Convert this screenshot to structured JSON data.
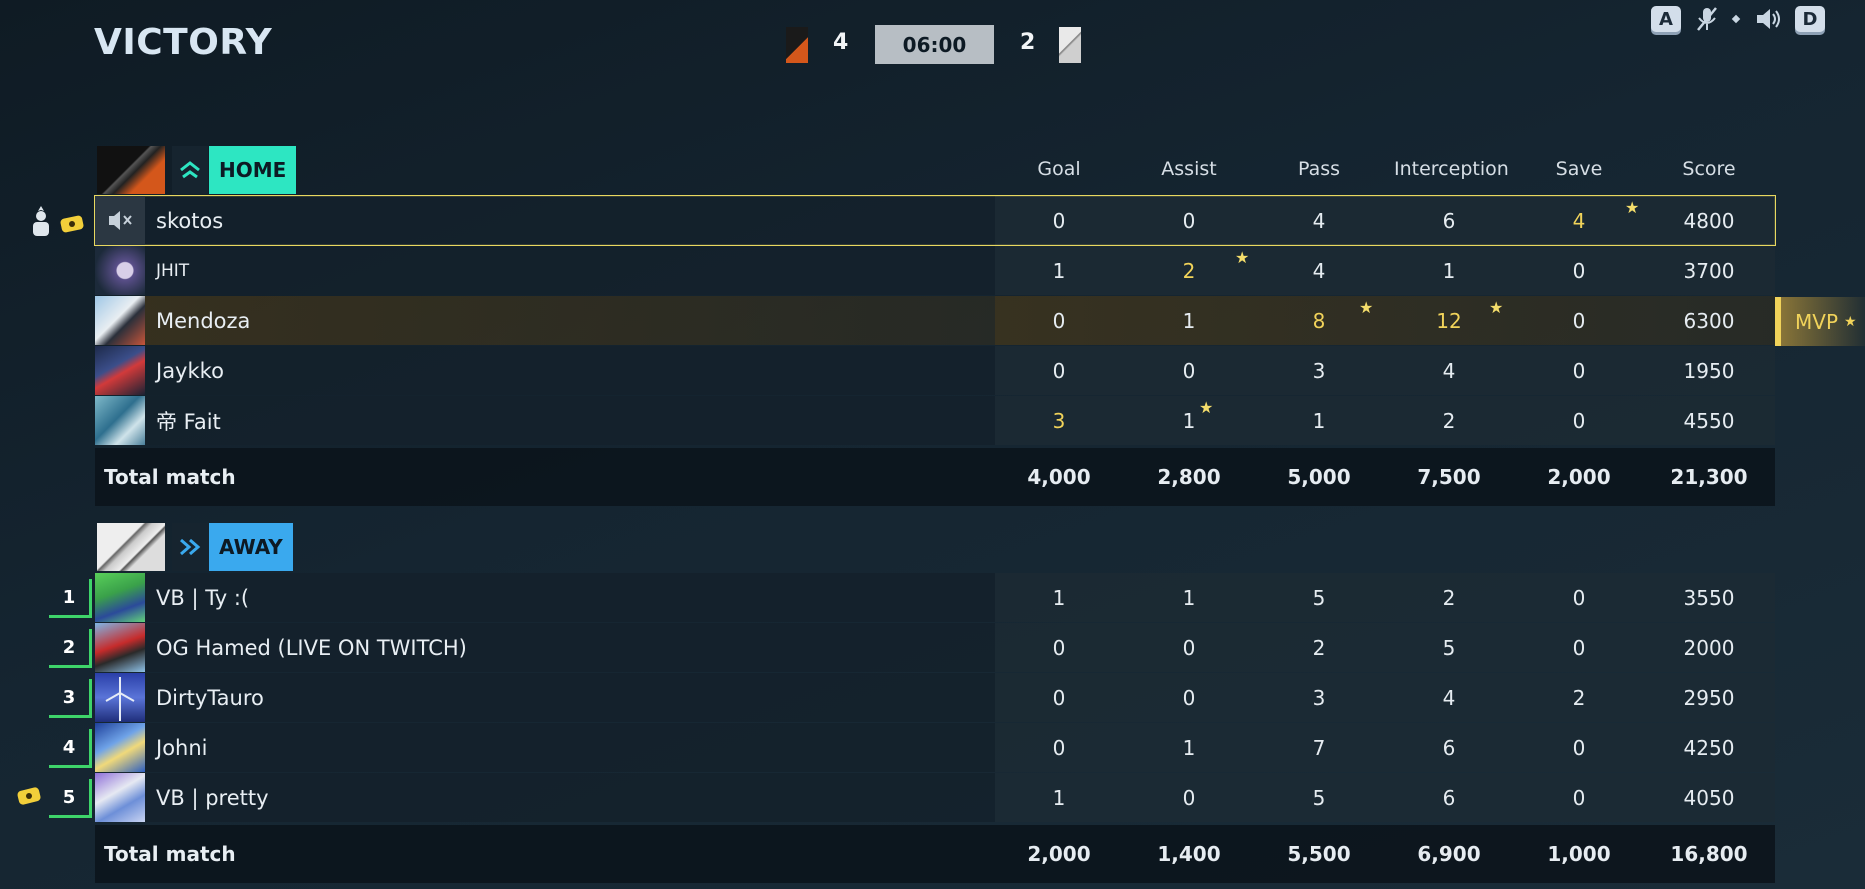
{
  "header": {
    "result": "VICTORY",
    "home_score": "4",
    "away_score": "2",
    "timer": "06:00",
    "key_left": "A",
    "key_right": "D"
  },
  "columns": [
    "Goal",
    "Assist",
    "Pass",
    "Interception",
    "Save",
    "Score"
  ],
  "home": {
    "label": "HOME",
    "color": "#2de6c2",
    "players": [
      {
        "name": "skotos",
        "stats": [
          "0",
          "0",
          "4",
          "6",
          "4",
          "4800"
        ]
      },
      {
        "name": "JHIT",
        "stats": [
          "1",
          "2",
          "4",
          "1",
          "0",
          "3700"
        ]
      },
      {
        "name": "Mendoza",
        "stats": [
          "0",
          "1",
          "8",
          "12",
          "0",
          "6300"
        ]
      },
      {
        "name": "Jaykko",
        "stats": [
          "0",
          "0",
          "3",
          "4",
          "0",
          "1950"
        ]
      },
      {
        "name": "帝 Fait",
        "stats": [
          "3",
          "1",
          "1",
          "2",
          "0",
          "4550"
        ]
      }
    ],
    "total_label": "Total match",
    "totals": [
      "4,000",
      "2,800",
      "5,000",
      "7,500",
      "2,000",
      "21,300"
    ]
  },
  "away": {
    "label": "AWAY",
    "color": "#3aa9ee",
    "players": [
      {
        "rank": "1",
        "name": "VB | Ty :(",
        "stats": [
          "1",
          "1",
          "5",
          "2",
          "0",
          "3550"
        ]
      },
      {
        "rank": "2",
        "name": "OG Hamed (LIVE ON TWITCH)",
        "stats": [
          "0",
          "0",
          "2",
          "5",
          "0",
          "2000"
        ]
      },
      {
        "rank": "3",
        "name": "DirtyTauro",
        "stats": [
          "0",
          "0",
          "3",
          "4",
          "2",
          "2950"
        ]
      },
      {
        "rank": "4",
        "name": "Johni",
        "stats": [
          "0",
          "1",
          "7",
          "6",
          "0",
          "4250"
        ]
      },
      {
        "rank": "5",
        "name": "VB | pretty",
        "stats": [
          "1",
          "0",
          "5",
          "6",
          "0",
          "4050"
        ]
      }
    ],
    "total_label": "Total match",
    "totals": [
      "2,000",
      "1,400",
      "5,500",
      "6,900",
      "1,000",
      "16,800"
    ]
  },
  "mvp_label": "MVP"
}
